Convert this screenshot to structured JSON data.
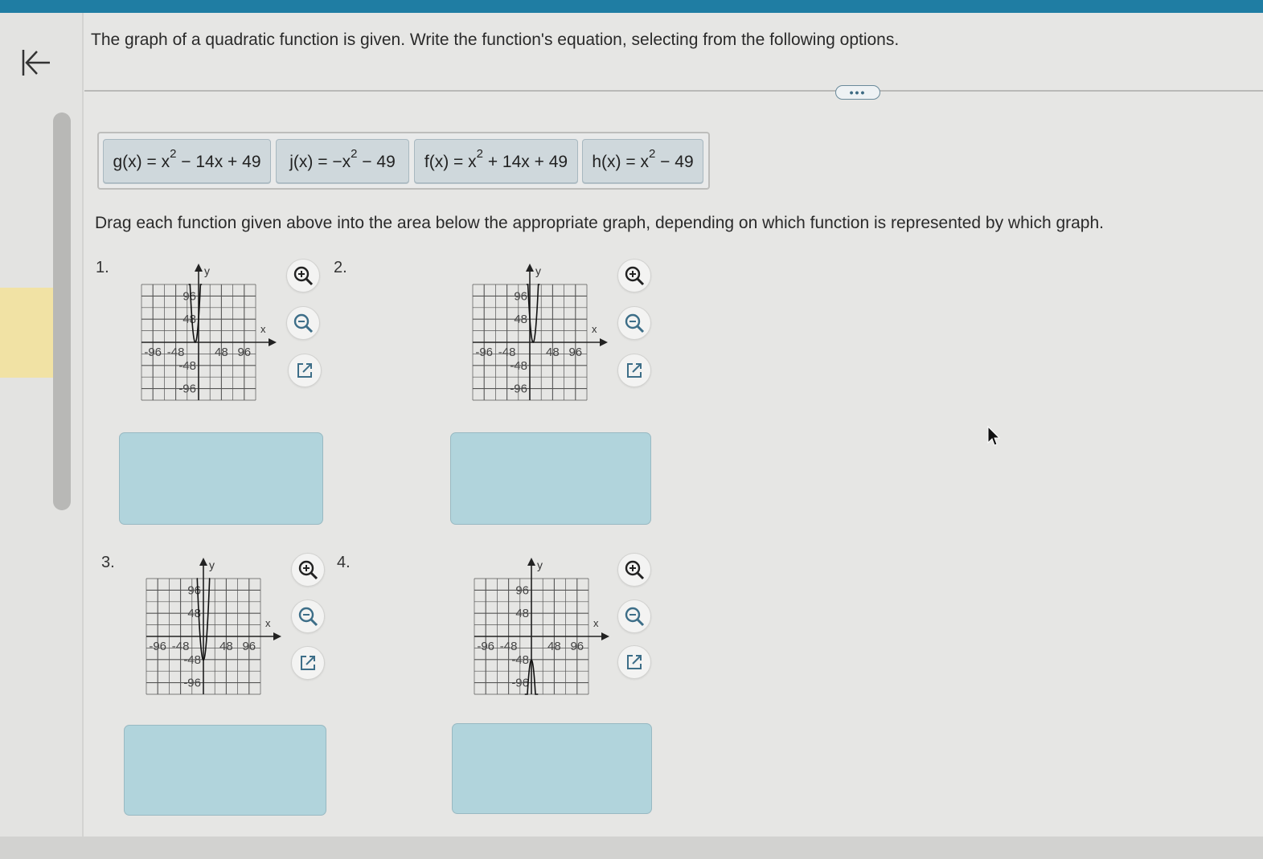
{
  "question": "The graph of a quadratic function is given. Write the function's equation, selecting from the following options.",
  "more_button": "•••",
  "options": [
    {
      "pre": "g(x) = x",
      "exp": "2",
      "post": " − 14x + 49"
    },
    {
      "pre": "j(x) = −x",
      "exp": "2",
      "post": " − 49"
    },
    {
      "pre": "f(x) = x",
      "exp": "2",
      "post": " + 14x + 49"
    },
    {
      "pre": "h(x) = x",
      "exp": "2",
      "post": " − 49"
    }
  ],
  "instructions": "Drag each function given above into the area below the appropriate graph, depending on which function is represented by which graph.",
  "graphs": [
    {
      "number": "1.",
      "x_label": "x",
      "y_label": "y",
      "x_ticks": [
        "-96",
        "-48",
        "48",
        "96"
      ],
      "y_ticks": [
        "96",
        "48",
        "-48",
        "-96"
      ],
      "vertex": [
        -7,
        0
      ],
      "opens": "up"
    },
    {
      "number": "2.",
      "x_label": "x",
      "y_label": "y",
      "x_ticks": [
        "-96",
        "-48",
        "48",
        "96"
      ],
      "y_ticks": [
        "96",
        "48",
        "-48",
        "-96"
      ],
      "vertex": [
        7,
        0
      ],
      "opens": "up"
    },
    {
      "number": "3.",
      "x_label": "x",
      "y_label": "y",
      "x_ticks": [
        "-96",
        "-48",
        "48",
        "96"
      ],
      "y_ticks": [
        "96",
        "48",
        "-48",
        "-96"
      ],
      "vertex": [
        0,
        -49
      ],
      "opens": "up"
    },
    {
      "number": "4.",
      "x_label": "x",
      "y_label": "y",
      "x_ticks": [
        "-96",
        "-48",
        "48",
        "96"
      ],
      "y_ticks": [
        "96",
        "48",
        "-48",
        "-96"
      ],
      "vertex": [
        0,
        -49
      ],
      "opens": "down"
    }
  ],
  "tool_icons": [
    "zoom-in-icon",
    "zoom-out-icon",
    "open-external-icon"
  ]
}
